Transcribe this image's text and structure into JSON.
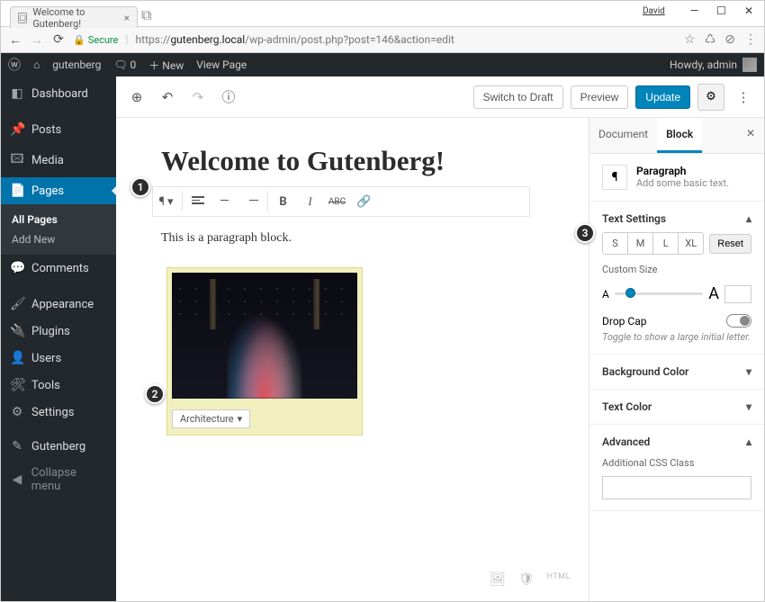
{
  "window": {
    "user_label": "David",
    "tab_title": "Welcome to Gutenberg!"
  },
  "browser": {
    "secure_label": "Secure",
    "host": "gutenberg.local",
    "path": "/wp-admin/post.php?post=146&action=edit"
  },
  "adminbar": {
    "site": "gutenberg",
    "comments": "0",
    "new": "New",
    "view": "View Page",
    "howdy": "Howdy, admin"
  },
  "sidebar": {
    "dashboard": "Dashboard",
    "posts": "Posts",
    "media": "Media",
    "pages": "Pages",
    "all_pages": "All Pages",
    "add_new": "Add New",
    "comments": "Comments",
    "appearance": "Appearance",
    "plugins": "Plugins",
    "users": "Users",
    "tools": "Tools",
    "settings": "Settings",
    "gutenberg": "Gutenberg",
    "collapse": "Collapse menu"
  },
  "toolbar": {
    "switch_draft": "Switch to Draft",
    "preview": "Preview",
    "update": "Update"
  },
  "post": {
    "title": "Welcome to Gutenberg!",
    "paragraph_text": "This is a paragraph block.",
    "image_category": "Architecture"
  },
  "inspector": {
    "tab_document": "Document",
    "tab_block": "Block",
    "block_name": "Paragraph",
    "block_desc": "Add some basic text.",
    "text_settings": "Text Settings",
    "sizes": {
      "s": "S",
      "m": "M",
      "l": "L",
      "xl": "XL"
    },
    "reset": "Reset",
    "custom_size": "Custom Size",
    "drop_cap": "Drop Cap",
    "drop_cap_hint": "Toggle to show a large initial letter.",
    "bg_color": "Background Color",
    "text_color": "Text Color",
    "advanced": "Advanced",
    "css_class": "Additional CSS Class"
  },
  "annotations": {
    "n1": "1",
    "n2": "2",
    "n3": "3"
  }
}
